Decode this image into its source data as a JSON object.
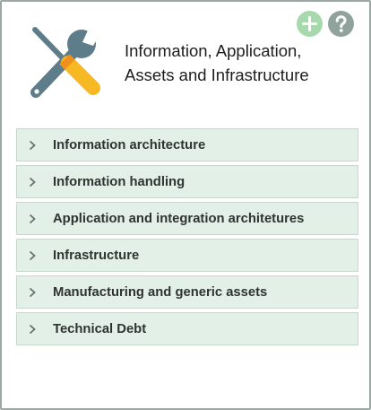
{
  "panel": {
    "title": "Information, Application,\nAssets and Infrastructure",
    "logo_icon": "tools-icon",
    "add_icon": "plus-icon",
    "help_icon": "question-icon"
  },
  "colors": {
    "item_background": "#e3f0e7",
    "add_button": "#a8d9ad",
    "help_button": "#8fa39c",
    "wrench": "#5e7d8a",
    "screwdriver": "#f6b923"
  },
  "sections": [
    {
      "label": "Information architecture"
    },
    {
      "label": "Information handling"
    },
    {
      "label": "Application and integration architetures"
    },
    {
      "label": "Infrastructure"
    },
    {
      "label": "Manufacturing and generic assets"
    },
    {
      "label": "Technical Debt"
    }
  ]
}
